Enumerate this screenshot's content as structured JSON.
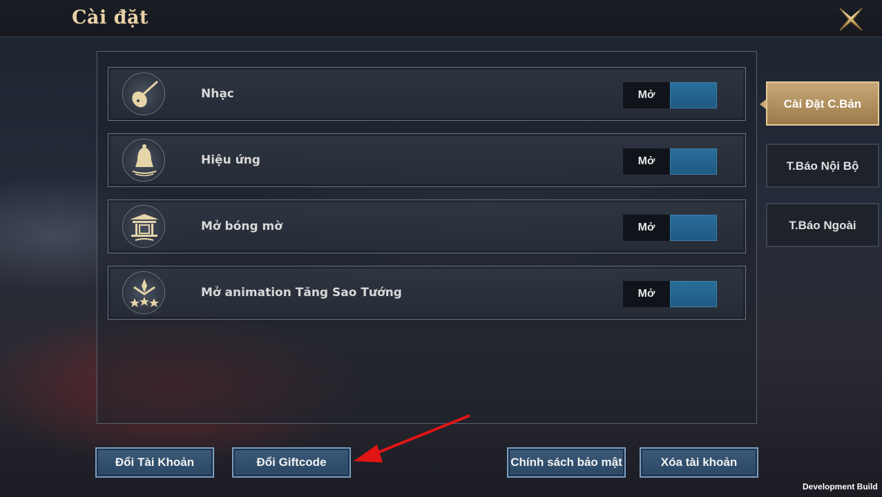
{
  "header": {
    "title": "Cài đặt",
    "close_icon": "close-x-icon"
  },
  "settings": [
    {
      "label": "Nhạc",
      "icon": "lute-icon",
      "state": "Mở"
    },
    {
      "label": "Hiệu ứng",
      "icon": "bell-icon",
      "state": "Mở"
    },
    {
      "label": "Mở bóng mờ",
      "icon": "pavilion-icon",
      "state": "Mở"
    },
    {
      "label": "Mở animation Tăng Sao Tướng",
      "icon": "stars-icon",
      "state": "Mở"
    }
  ],
  "tabs": [
    {
      "label": "Cài Đặt C.Bản",
      "active": true
    },
    {
      "label": "T.Báo Nội Bộ",
      "active": false
    },
    {
      "label": "T.Báo Ngoài",
      "active": false
    }
  ],
  "buttons": {
    "switch_account": "Đổi Tài Khoản",
    "giftcode": "Đổi Giftcode",
    "privacy": "Chính sách bảo mật",
    "delete_account": "Xóa tài khoản"
  },
  "footer": {
    "dev_build": "Development Build"
  },
  "colors": {
    "gold": "#e9d2a6",
    "toggle_on": "#2a6d9a",
    "button": "#3b5a78",
    "annotation_arrow": "#e01515"
  }
}
